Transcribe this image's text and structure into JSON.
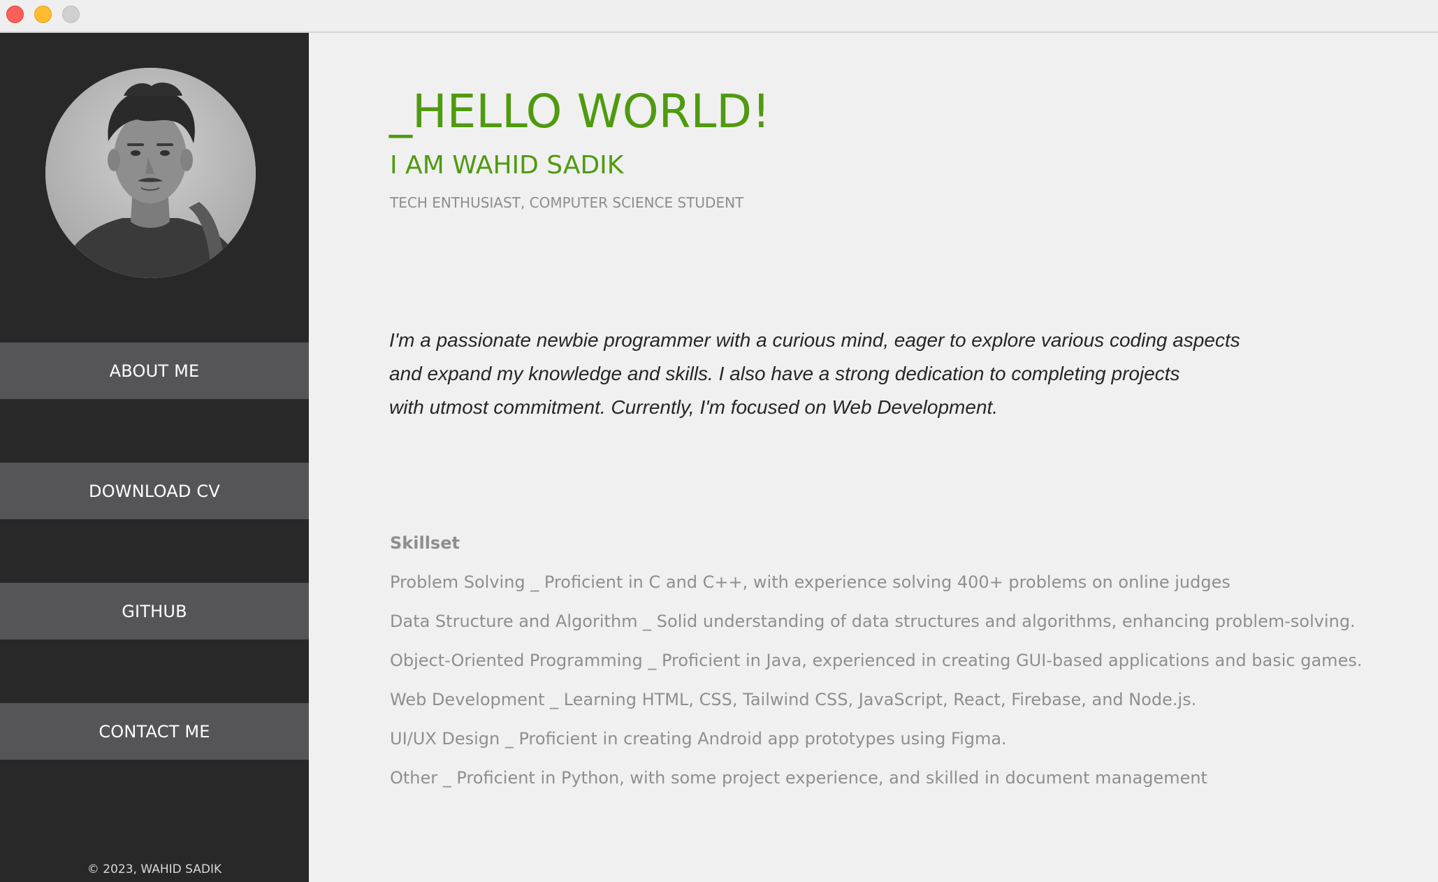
{
  "window": {
    "controls": [
      "close",
      "minimize",
      "maximize"
    ]
  },
  "sidebar": {
    "avatar_icon": "profile-photo",
    "nav": {
      "about": "ABOUT ME",
      "cv": "DOWNLOAD CV",
      "github": "GITHUB",
      "contact": "CONTACT ME"
    },
    "footer": "© 2023, WAHID SADIK"
  },
  "main": {
    "greeting": "_HELLO WORLD!",
    "name": "I AM WAHID SADIK",
    "subtitle": "TECH ENTHUSIAST, COMPUTER SCIENCE STUDENT",
    "bio_lines": [
      "I'm a passionate newbie programmer with a curious mind, eager to explore various coding aspects",
      "and expand my knowledge and skills. I also have a strong dedication to completing projects",
      "with utmost commitment. Currently, I'm focused on Web Development."
    ],
    "skills_title": "Skillset",
    "skills": [
      "Problem Solving _  Proficient in C and C++, with experience solving 400+ problems on online judges",
      "Data Structure and Algorithm  _  Solid understanding of data structures and algorithms, enhancing problem-solving.",
      "Object-Oriented Programming  _  Proficient in Java, experienced in creating GUI-based applications and basic games.",
      "Web Development _  Learning HTML, CSS, Tailwind CSS, JavaScript, React, Firebase, and Node.js.",
      "UI/UX Design _  Proficient in creating Android app prototypes using Figma.",
      "Other _  Proficient in Python, with some project experience, and skilled in document management"
    ]
  },
  "colors": {
    "accent_green": "#4f9a0f",
    "sidebar_bg": "#282828",
    "nav_button_bg": "#555456",
    "page_bg": "#f0f0f0"
  }
}
